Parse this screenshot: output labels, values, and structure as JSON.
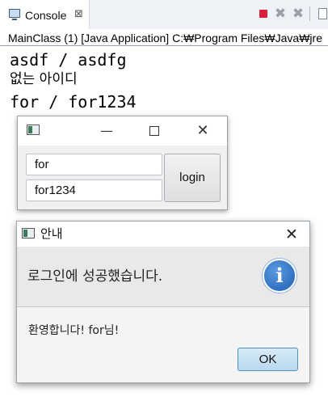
{
  "console": {
    "tab_label": "Console",
    "tab_close": "⊠",
    "toolbar_icons": [
      "terminate-icon",
      "remove-launch-icon",
      "remove-all-terminated-icon",
      "pin-console-icon"
    ],
    "launch_line": "MainClass (1) [Java Application] C:₩Program Files₩Java₩jre",
    "output_lines": [
      "asdf / asdfg",
      "없는 아이디",
      "for / for1234"
    ],
    "colors": {
      "terminate": "#d9203a"
    }
  },
  "login_window": {
    "controls": {
      "minimize": "—",
      "close": "✕"
    },
    "id_value": "for",
    "password_value": "for1234",
    "login_button": "login"
  },
  "info_dialog": {
    "title": "안내",
    "close_glyph": "✕",
    "header_text": "로그인에 성공했습니다.",
    "info_glyph": "i",
    "content_text": "환영합니다! for님!",
    "ok_button": "OK"
  }
}
